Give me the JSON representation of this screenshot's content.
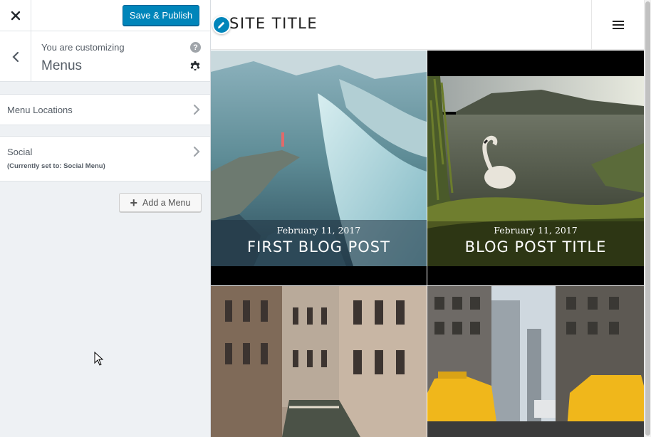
{
  "customizer": {
    "close_icon": "close-icon",
    "publish_label": "Save & Publish",
    "customizing_label": "You are customizing",
    "section_title": "Menus",
    "help_icon_text": "?",
    "panels": [
      {
        "label": "Menu Locations",
        "sublabel": ""
      },
      {
        "label": "Social",
        "sublabel": "(Currently set to: Social Menu)"
      }
    ],
    "add_menu_label": "Add a Menu",
    "accent_color": "#0085ba"
  },
  "preview": {
    "site_title": "SITE TITLE",
    "posts": [
      {
        "date": "February 11, 2017",
        "title": "FIRST BLOG POST",
        "image": "mountain-cliff-photo"
      },
      {
        "date": "February 11, 2017",
        "title": "BLOG POST TITLE",
        "image": "swan-lake-photo"
      },
      {
        "date": "",
        "title": "",
        "image": "venice-canal-photo"
      },
      {
        "date": "",
        "title": "",
        "image": "city-taxi-street-photo"
      }
    ]
  }
}
